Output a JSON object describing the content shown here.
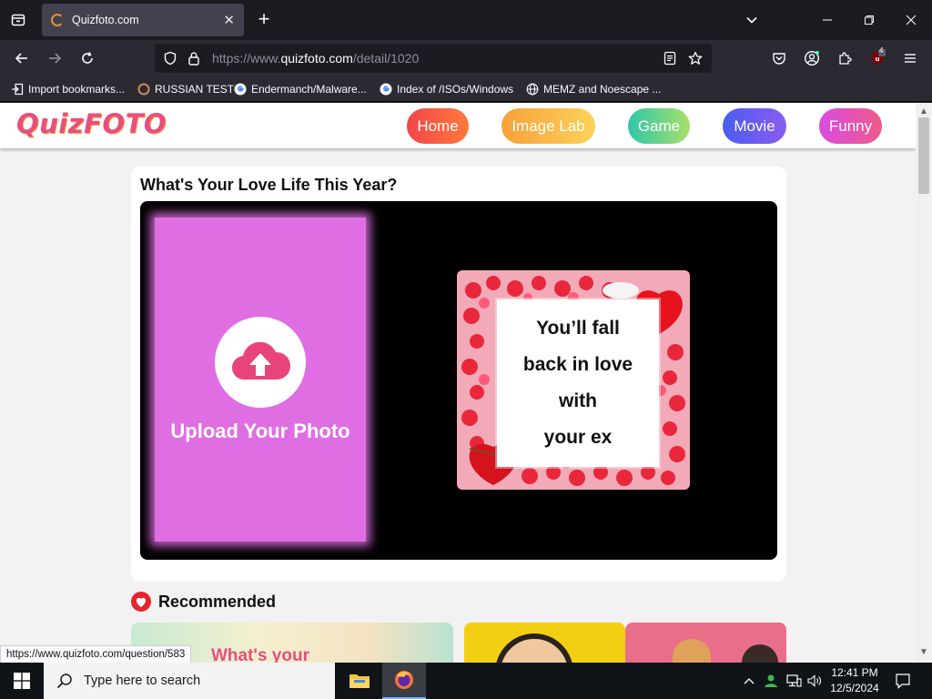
{
  "browser": {
    "tab_title": "Quizfoto.com",
    "tab_close": "✕",
    "new_tab": "+",
    "url_prefix": "https://www.",
    "url_host": "quizfoto.com",
    "url_path": "/detail/1020",
    "extension_badge": "4",
    "bookmarks": [
      {
        "label": "Import bookmarks...",
        "icon": "import-icon"
      },
      {
        "label": "RUSSIAN TEST",
        "icon": "site-favicon"
      },
      {
        "label": "Endermanch/Malware...",
        "icon": "google-icon"
      },
      {
        "label": "Index of /ISOs/Windows",
        "icon": "google-icon"
      },
      {
        "label": "MEMZ and Noescape ...",
        "icon": "globe-icon"
      }
    ]
  },
  "site": {
    "logo": "QuizFOTO",
    "nav": [
      {
        "label": "Home",
        "color_from": "#f0454b",
        "color_to": "#ff7a3a"
      },
      {
        "label": "Image Lab",
        "color_from": "#f7a13b",
        "color_to": "#fcd25a"
      },
      {
        "label": "Game",
        "color_from": "#2ec7a8",
        "color_to": "#a8e06a"
      },
      {
        "label": "Movie",
        "color_from": "#4b5cf0",
        "color_to": "#8a5cf0"
      },
      {
        "label": "Funny",
        "color_from": "#d94be0",
        "color_to": "#f05a8a"
      }
    ]
  },
  "quiz": {
    "title": "What's Your Love Life This Year?",
    "upload_label": "Upload Your Photo",
    "result_lines": [
      "You’ll fall",
      "back in love",
      "with",
      "your ex"
    ]
  },
  "recommended": {
    "heading": "Recommended",
    "first_thumb_text": "What's your"
  },
  "status_bar": {
    "link": "https://www.quizfoto.com/question/583"
  },
  "taskbar": {
    "search_placeholder": "Type here to search",
    "time": "12:41 PM",
    "date": "12/5/2024"
  }
}
